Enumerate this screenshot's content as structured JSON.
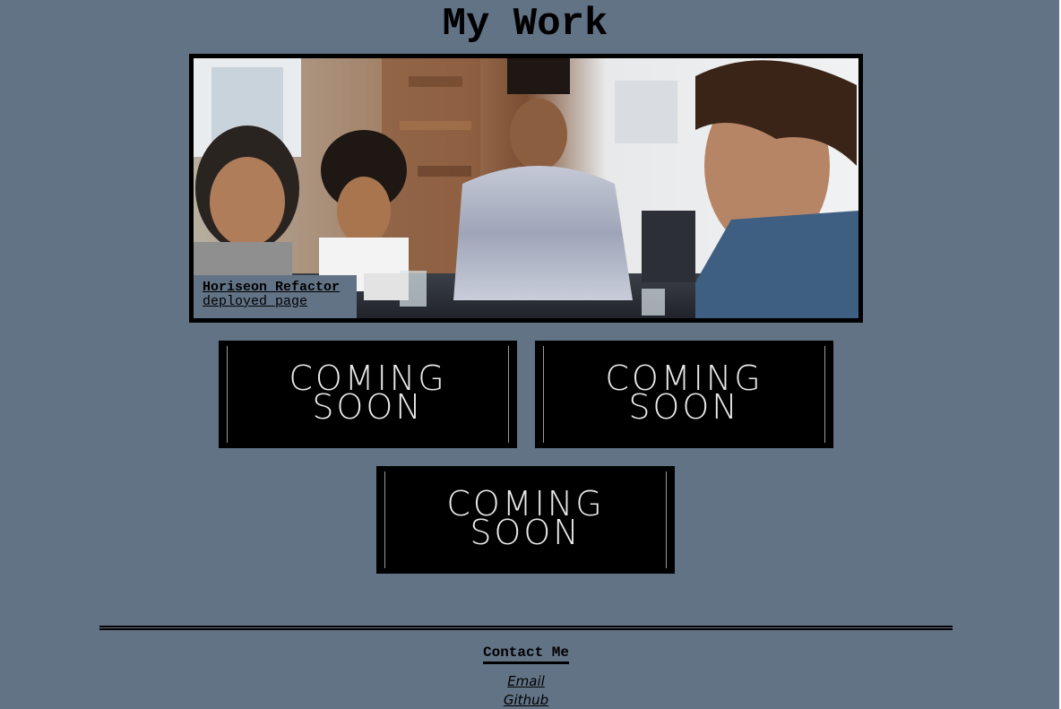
{
  "page": {
    "title": "My Work"
  },
  "featured_project": {
    "title": "Horiseon Refactor",
    "link_label": "deployed page"
  },
  "upcoming_projects": [
    {
      "label": "COMING\nSOON"
    },
    {
      "label": "COMING\nSOON"
    },
    {
      "label": "COMING\nSOON"
    }
  ],
  "contact": {
    "heading": "Contact Me",
    "links": [
      {
        "label": "Email"
      },
      {
        "label": "Github"
      }
    ]
  },
  "colors": {
    "background": "#627386",
    "frame": "#000000",
    "text": "#000000"
  }
}
